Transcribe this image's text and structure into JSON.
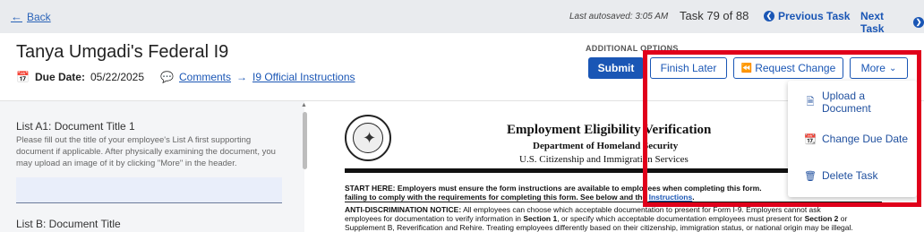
{
  "topbar": {
    "back_label": "Back",
    "autosave": "Last autosaved: 3:05 AM",
    "task_counter": "Task 79 of 88",
    "prev_label": "Previous Task",
    "next_label": "Next Task"
  },
  "header": {
    "title": "Tanya Umgadi's Federal I9",
    "due_label": "Due Date:",
    "due_value": "05/22/2025",
    "comments_label": "Comments",
    "instructions_label": "I9 Official Instructions",
    "additional_options": "ADDITIONAL OPTIONS",
    "submit_label": "Submit",
    "finish_later_label": "Finish Later",
    "request_change_label": "Request Change",
    "more_label": "More"
  },
  "dropdown": {
    "items": [
      {
        "label": "Upload a Document",
        "icon": "file-icon"
      },
      {
        "label": "Change Due Date",
        "icon": "calendar-check-icon"
      },
      {
        "label": "Delete Task",
        "icon": "trash-icon"
      }
    ]
  },
  "left_panel": {
    "field1_title": "List A1: Document Title 1",
    "field1_desc": "Please fill out the title of your employee's List A first supporting document if applicable. After physically examining the document, you may upload an image of it by clicking \"More\" in the header.",
    "field1_value": "",
    "field2_title": "List B: Document Title"
  },
  "document": {
    "title": "Employment Eligibility Verification",
    "sub1": "Department of Homeland Security",
    "sub2": "U.S. Citizenship and Immigration Services",
    "line1_bold": "START HERE:  Employers must ensure the form instructions are available to employees when completing this form.",
    "line2_bold": "failing to comply with the requirements for completing this form.  See below and the",
    "line2_link": "Instructions",
    "line3_bold": "ANTI-DISCRIMINATION NOTICE:",
    "line3": " All employees can choose which acceptable documentation to present for Form I-9.  Employers cannot ask",
    "line4a": "employees for documentation to verify information in ",
    "line4b": "Section 1",
    "line4c": ", or specify which acceptable documentation employees must present for ",
    "line4d": "Section 2",
    "line4e": " or",
    "line5": "Supplement B, Reverification and Rehire.  Treating employees differently based on their citizenship, immigration status, or national origin may be illegal."
  },
  "colors": {
    "accent": "#1a56b5",
    "highlight": "#e0001b",
    "topbar_bg": "#e9ebee"
  }
}
